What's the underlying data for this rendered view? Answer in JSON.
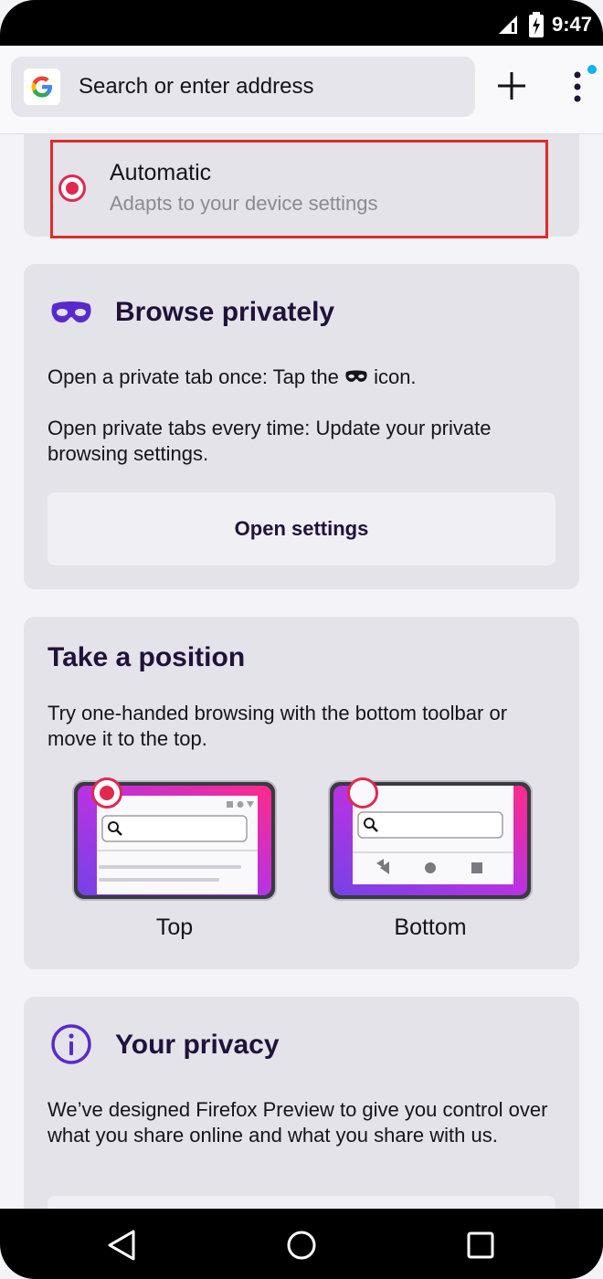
{
  "status_bar": {
    "time": "9:47"
  },
  "toolbar": {
    "address_placeholder": "Search or enter address",
    "search_engine_icon": "google-icon",
    "new_tab_icon": "plus-icon",
    "menu_icon": "three-dot-menu-icon"
  },
  "theme_option": {
    "title": "Automatic",
    "subtitle": "Adapts to your device settings",
    "selected": true
  },
  "browse_privately": {
    "title": "Browse privately",
    "line1_before": "Open a private tab once: Tap the",
    "line1_after": "icon.",
    "line2": "Open private tabs every time: Update your private browsing settings.",
    "button": "Open settings"
  },
  "take_position": {
    "title": "Take a position",
    "description": "Try one-handed browsing with the bottom toolbar or move it to the top.",
    "options": [
      {
        "label": "Top",
        "selected": true
      },
      {
        "label": "Bottom",
        "selected": false
      }
    ]
  },
  "your_privacy": {
    "title": "Your privacy",
    "description": "We’ve designed Firefox Preview to give you control over what you share online and what you share with us."
  },
  "colors": {
    "accent_red": "#e22850",
    "purple": "#592acb",
    "card_bg": "#e4e3ea"
  }
}
